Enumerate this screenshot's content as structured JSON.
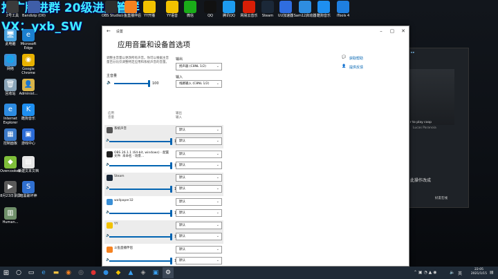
{
  "overlay": {
    "line1": "推广牌进群 20级进房管群",
    "line2": "VX：yxb_SW"
  },
  "desktop_icons": [
    {
      "label": "此电脑",
      "color": "#4aa3df",
      "glyph": "🖥"
    },
    {
      "label": "Microsoft Edge",
      "color": "#1b7fcf",
      "glyph": "e"
    },
    {
      "label": "网络",
      "color": "#3a8fd6",
      "glyph": "🌐"
    },
    {
      "label": "Google Chrome",
      "color": "#e8b100",
      "glyph": "◉"
    },
    {
      "label": "回收站",
      "color": "#8aa4b8",
      "glyph": "🗑"
    },
    {
      "label": "Administ...",
      "color": "#d9b44a",
      "glyph": "👤"
    },
    {
      "label": "Internet Explorer",
      "color": "#2d8be0",
      "glyph": "e"
    },
    {
      "label": "酷狗音乐",
      "color": "#1e8ff0",
      "glyph": "K"
    },
    {
      "label": "控制面板",
      "color": "#3b79c7",
      "glyph": "▦"
    },
    {
      "label": "游戏中心",
      "color": "#2b6bd6",
      "glyph": "▣"
    },
    {
      "label": "Overcooked",
      "color": "#7fbf3a",
      "glyph": "◆"
    },
    {
      "label": "新建文本文档",
      "color": "#e6e6e6",
      "glyph": "▤"
    },
    {
      "label": "8月23日录屏",
      "color": "#5a5a5a",
      "glyph": "▶"
    },
    {
      "label": "暗黑破坏神",
      "color": "#2f6fd0",
      "glyph": "S"
    },
    {
      "label": "Human...",
      "color": "#6f8f6a",
      "glyph": "▥"
    }
  ],
  "top_icons": [
    {
      "label": "2号工具",
      "color": "#3b3b3b"
    },
    {
      "label": "Bandizip (D0)",
      "color": "#3f5ea8"
    },
    {
      "label": "OBS Studio",
      "color": "#2e2e2e"
    },
    {
      "label": "斗鱼直播伴侣",
      "color": "#f58220"
    },
    {
      "label": "YY开播",
      "color": "#f2c200"
    },
    {
      "label": "YY语音",
      "color": "#f2c200"
    },
    {
      "label": "微信",
      "color": "#1aad19"
    },
    {
      "label": "QQ",
      "color": "#111111"
    },
    {
      "label": "腾讯QQ",
      "color": "#1d9bf0"
    },
    {
      "label": "网易云音乐",
      "color": "#d81e06"
    },
    {
      "label": "Steam",
      "color": "#1b2838"
    },
    {
      "label": "UU加速器",
      "color": "#2f6de0"
    },
    {
      "label": "Sam12启动器",
      "color": "#2e8de0"
    },
    {
      "label": "酷狗音乐",
      "color": "#1e8ff0"
    },
    {
      "label": "iTools 4",
      "color": "#1e7fe0"
    }
  ],
  "window": {
    "title": "设置",
    "page_title": "应用音量和设备首选项",
    "description": "调整主音量以更改所有声音。你可以根据主音量百分比仅调整特定应用和系统声音的音量。",
    "master_label": "主音量",
    "master_value": "100",
    "master_level": 1.0,
    "output_label": "输出",
    "output_value": "扬声器 (C8NL 1/2)",
    "input_label": "输入",
    "input_value": "线路输入 (C8NL 1/2)",
    "help_link": "获取帮助",
    "feedback_link": "提供反馈",
    "col_app": "应用",
    "col_volume": "音量",
    "col_output": "输出",
    "col_input": "输入",
    "apps": [
      {
        "name": "系统声音",
        "value": "100",
        "level": 1.0,
        "icon_color": "#555",
        "out": "默认",
        "in": "默认"
      },
      {
        "name": "OBS 26.1.1 (64-bit, windows) - 配置文件: 未命名 - 场景...",
        "value": "100",
        "level": 1.0,
        "icon_color": "#222",
        "out": "默认",
        "in": "默认"
      },
      {
        "name": "Steam",
        "value": "100",
        "level": 1.0,
        "icon_color": "#1b2838",
        "out": "默认",
        "in": "默认"
      },
      {
        "name": "wallpaper32",
        "value": "100",
        "level": 1.0,
        "icon_color": "#3a8fd6",
        "out": "默认",
        "in": "默认"
      },
      {
        "name": "YY",
        "value": "100",
        "level": 1.0,
        "icon_color": "#f2c200",
        "out": "默认",
        "in": "默认"
      },
      {
        "name": "斗鱼直播伴侣",
        "value": "100",
        "level": 1.0,
        "icon_color": "#f58220",
        "out": "默认",
        "in": "默认"
      }
    ],
    "default_option": "默认"
  },
  "bg_window": {
    "text1": "r to play coop",
    "text2": "Lucas Paranoia",
    "text3": "此操作改成",
    "text4": "好友在线"
  },
  "taskbar": {
    "time": "22:05",
    "date": "2021/1/15",
    "lang": "英",
    "ai": "Ai"
  }
}
